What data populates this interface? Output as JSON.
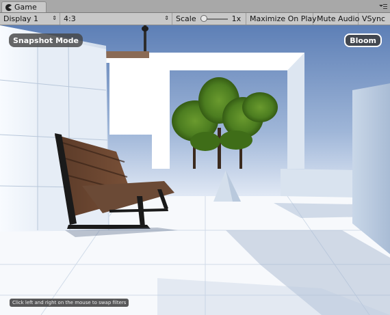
{
  "tab": {
    "label": "Game",
    "icon": "pacman-icon"
  },
  "toolbar": {
    "display": "Display 1",
    "aspect": "4:3",
    "scale_label": "Scale",
    "scale_value": "1x",
    "scale_level": 0.0,
    "maximize_on_play": "Maximize On Play",
    "mute_audio": "Mute Audio",
    "vsync": "VSync"
  },
  "overlay": {
    "snapshot_mode": "Snapshot Mode",
    "filter_button": "Bloom",
    "hint": "Click left and right on the mouse to swap filters"
  }
}
